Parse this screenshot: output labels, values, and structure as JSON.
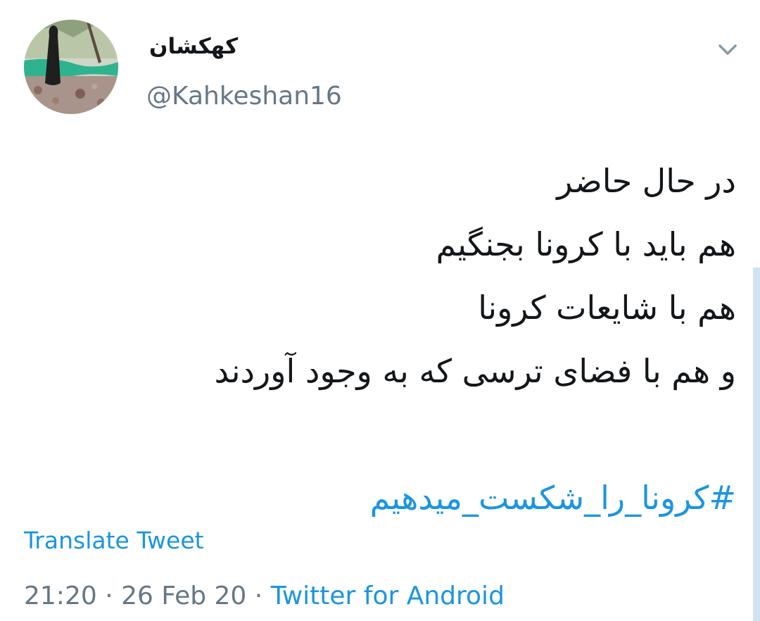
{
  "user": {
    "display_name": "کهکشان",
    "handle": "@Kahkeshan16",
    "avatar_icon": "profile-photo"
  },
  "menu": {
    "icon": "chevron-down-icon"
  },
  "tweet": {
    "lines": [
      "در حال حاضر",
      "هم باید با کرونا بجنگیم",
      "هم با شایعات کرونا",
      "و هم با فضای ترسی که به وجود آوردند"
    ],
    "hashtag": "#کرونا_را_شکست_میدهیم"
  },
  "translate_label": "Translate Tweet",
  "meta": {
    "time": "21:20",
    "separator1": " · ",
    "date": "26 Feb 20",
    "separator2": " · ",
    "source": "Twitter for Android"
  },
  "colors": {
    "link": "#1b95e0",
    "secondary_text": "#657786",
    "primary_text": "#14171a"
  }
}
